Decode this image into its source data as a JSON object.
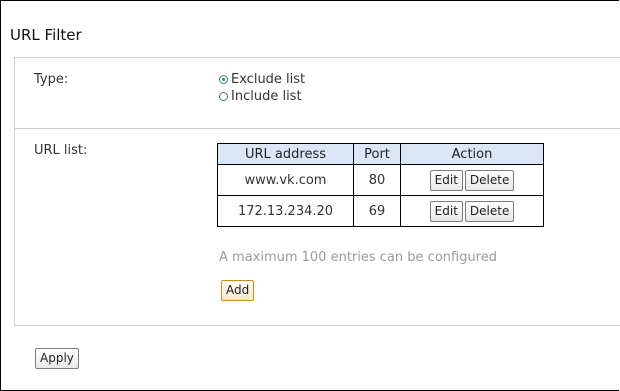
{
  "page": {
    "title": "URL Filter"
  },
  "type_section": {
    "label": "Type:",
    "options": [
      {
        "label": "Exclude list",
        "selected": true
      },
      {
        "label": "Include list",
        "selected": false
      }
    ]
  },
  "url_list": {
    "label": "URL list:",
    "columns": [
      "URL address",
      "Port",
      "Action"
    ],
    "rows": [
      {
        "url": "www.vk.com",
        "port": "80",
        "edit": "Edit",
        "delete": "Delete"
      },
      {
        "url": "172.13.234.20",
        "port": "69",
        "edit": "Edit",
        "delete": "Delete"
      }
    ],
    "hint": "A maximum 100 entries can be configured",
    "add_label": "Add"
  },
  "footer": {
    "apply_label": "Apply"
  }
}
